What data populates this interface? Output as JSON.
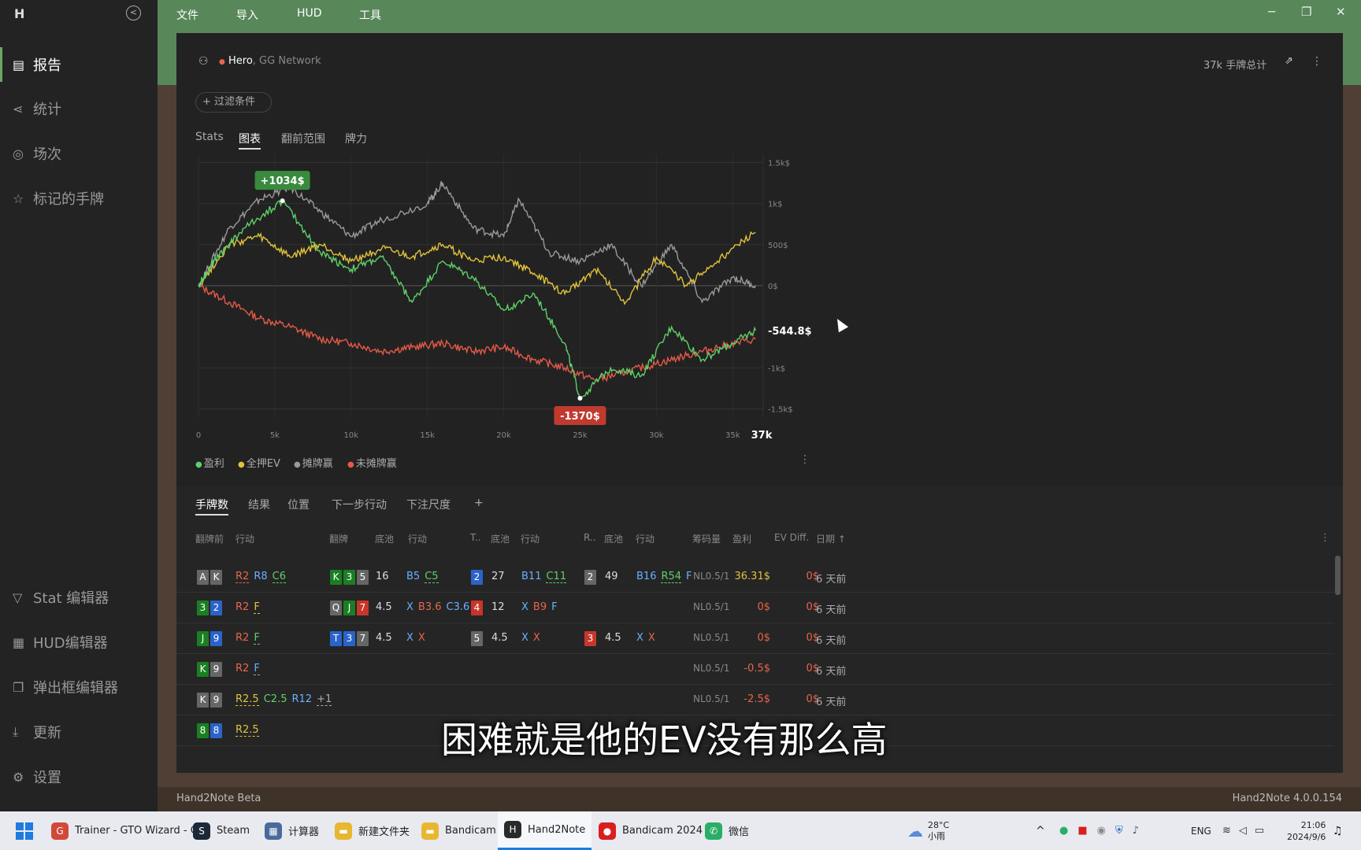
{
  "sidebar": {
    "logo": "H",
    "items": [
      {
        "label": "报告",
        "icon": "report-icon"
      },
      {
        "label": "统计",
        "icon": "share-icon"
      },
      {
        "label": "场次",
        "icon": "broadcast-icon"
      },
      {
        "label": "标记的手牌",
        "icon": "star-icon"
      }
    ],
    "bottom": [
      {
        "label": "Stat 编辑器",
        "icon": "filter-icon"
      },
      {
        "label": "HUD编辑器",
        "icon": "layout-icon"
      },
      {
        "label": "弹出框编辑器",
        "icon": "popup-icon"
      },
      {
        "label": "更新",
        "icon": "download-icon"
      },
      {
        "label": "设置",
        "icon": "gear-icon"
      }
    ]
  },
  "menu": [
    "文件",
    "导入",
    "HUD",
    "工具"
  ],
  "player": {
    "name": "Hero",
    "network": ", GG Network",
    "total": "37k 手牌总计"
  },
  "filter": "+ 过滤条件",
  "tabs": [
    "Stats",
    "图表",
    "翻前范围",
    "牌力"
  ],
  "chart_data": {
    "type": "line",
    "xlim": [
      0,
      37000
    ],
    "ylim": [
      -1600,
      1600
    ],
    "x_ticks": [
      "0",
      "5k",
      "10k",
      "15k",
      "20k",
      "25k",
      "30k",
      "35k"
    ],
    "x_end": "37k",
    "y_ticks": [
      "1.5k$",
      "1k$",
      "500$",
      "0$",
      "-1k$",
      "-1.5k$"
    ],
    "annotations": {
      "max": "+1034$",
      "min": "-1370$",
      "last": "-544.8$"
    },
    "series": [
      {
        "name": "盈利",
        "color": "#5fd068",
        "points": [
          [
            0,
            0
          ],
          [
            1000,
            300
          ],
          [
            3000,
            700
          ],
          [
            5500,
            1034
          ],
          [
            8000,
            400
          ],
          [
            10000,
            200
          ],
          [
            12000,
            350
          ],
          [
            14000,
            -200
          ],
          [
            16000,
            300
          ],
          [
            18000,
            100
          ],
          [
            20000,
            -300
          ],
          [
            22000,
            -100
          ],
          [
            24000,
            -700
          ],
          [
            25000,
            -1370
          ],
          [
            27000,
            -1000
          ],
          [
            29000,
            -1100
          ],
          [
            31000,
            -500
          ],
          [
            33000,
            -900
          ],
          [
            35000,
            -700
          ],
          [
            36500,
            -544.8
          ]
        ]
      },
      {
        "name": "全押EV",
        "color": "#e2c23b",
        "points": [
          [
            0,
            0
          ],
          [
            2000,
            500
          ],
          [
            4000,
            600
          ],
          [
            6000,
            350
          ],
          [
            8000,
            500
          ],
          [
            10000,
            300
          ],
          [
            12000,
            450
          ],
          [
            14000,
            350
          ],
          [
            16000,
            500
          ],
          [
            18000,
            300
          ],
          [
            20000,
            350
          ],
          [
            22000,
            150
          ],
          [
            24000,
            -100
          ],
          [
            26000,
            200
          ],
          [
            28000,
            -200
          ],
          [
            30000,
            350
          ],
          [
            32000,
            0
          ],
          [
            34000,
            300
          ],
          [
            36500,
            650
          ]
        ]
      },
      {
        "name": "摊牌赢",
        "color": "#9a9a9a",
        "points": [
          [
            0,
            0
          ],
          [
            2000,
            700
          ],
          [
            4000,
            1050
          ],
          [
            6000,
            1200
          ],
          [
            8000,
            900
          ],
          [
            10000,
            600
          ],
          [
            12000,
            800
          ],
          [
            15000,
            1000
          ],
          [
            16000,
            1250
          ],
          [
            18000,
            700
          ],
          [
            20000,
            600
          ],
          [
            21000,
            1050
          ],
          [
            23000,
            400
          ],
          [
            25000,
            300
          ],
          [
            27000,
            500
          ],
          [
            29000,
            0
          ],
          [
            31000,
            500
          ],
          [
            33000,
            -200
          ],
          [
            35000,
            100
          ],
          [
            36500,
            0
          ]
        ]
      },
      {
        "name": "未摊牌赢",
        "color": "#e55a48",
        "points": [
          [
            0,
            0
          ],
          [
            2000,
            -200
          ],
          [
            4000,
            -400
          ],
          [
            6000,
            -500
          ],
          [
            8000,
            -650
          ],
          [
            10000,
            -700
          ],
          [
            12000,
            -800
          ],
          [
            14000,
            -750
          ],
          [
            16000,
            -700
          ],
          [
            18000,
            -800
          ],
          [
            20000,
            -750
          ],
          [
            22000,
            -900
          ],
          [
            24000,
            -1000
          ],
          [
            26000,
            -1150
          ],
          [
            28000,
            -1050
          ],
          [
            30000,
            -950
          ],
          [
            32000,
            -850
          ],
          [
            34000,
            -750
          ],
          [
            36500,
            -650
          ]
        ]
      }
    ]
  },
  "table_tabs": [
    "手牌数",
    "结果",
    "位置",
    "下一步行动",
    "下注尺度",
    "+"
  ],
  "headers": [
    "翻牌前",
    "行动",
    "翻牌",
    "底池",
    "行动",
    "T..",
    "底池",
    "行动",
    "R..",
    "底池",
    "行动",
    "筹码量",
    "盈利",
    "EV Diff.",
    "日期 ↑"
  ],
  "rows": [
    {
      "hole": [
        [
          "A",
          "cd"
        ],
        [
          "K",
          "cd"
        ]
      ],
      "pre": [
        [
          "R2",
          "#e8664a",
          true
        ],
        [
          "R8",
          "#6ab0ff",
          false
        ],
        [
          "C6",
          "#5fd068",
          true
        ]
      ],
      "flop": [
        [
          "K",
          "cs"
        ],
        [
          "3",
          "cs"
        ],
        [
          "5",
          "cd"
        ]
      ],
      "fpot": "16",
      "fact": [
        [
          "B5",
          "#6ab0ff",
          false
        ],
        [
          "C5",
          "#5fd068",
          true
        ]
      ],
      "turn": [
        [
          "2",
          "cc"
        ]
      ],
      "tpot": "27",
      "tact": [
        [
          "B11",
          "#6ab0ff",
          false
        ],
        [
          "C11",
          "#5fd068",
          true
        ]
      ],
      "river": [
        [
          "2",
          "cd"
        ]
      ],
      "rpot": "49",
      "ract": [
        [
          "B16",
          "#6ab0ff",
          false
        ],
        [
          "R54",
          "#5fd068",
          true
        ],
        [
          "F",
          "#6ab0ff",
          false
        ]
      ],
      "stake": "NL0.5/1",
      "profit": "36.31$",
      "pcolor": "#e2c23b",
      "ev": "0$",
      "date": "6 天前"
    },
    {
      "hole": [
        [
          "3",
          "cs"
        ],
        [
          "2",
          "cc"
        ]
      ],
      "pre": [
        [
          "R2",
          "#e8664a",
          false
        ],
        [
          "F",
          "#e2c23b",
          true
        ]
      ],
      "flop": [
        [
          "Q",
          "cd"
        ],
        [
          "J",
          "cs"
        ],
        [
          "7",
          "ch"
        ]
      ],
      "fpot": "4.5",
      "fact": [
        [
          "X",
          "#6ab0ff",
          false
        ],
        [
          "B3.6",
          "#e8664a",
          false
        ],
        [
          "C3.6",
          "#6ab0ff",
          false
        ]
      ],
      "turn": [
        [
          "4",
          "ch"
        ]
      ],
      "tpot": "12",
      "tact": [
        [
          "X",
          "#6ab0ff",
          false
        ],
        [
          "B9",
          "#e8664a",
          false
        ],
        [
          "F",
          "#6ab0ff",
          false
        ]
      ],
      "river": [],
      "rpot": "",
      "ract": [],
      "stake": "NL0.5/1",
      "profit": "0$",
      "pcolor": "#e8664a",
      "ev": "0$",
      "date": "6 天前"
    },
    {
      "hole": [
        [
          "J",
          "cs"
        ],
        [
          "9",
          "cc"
        ]
      ],
      "pre": [
        [
          "R2",
          "#e8664a",
          false
        ],
        [
          "F",
          "#5fd068",
          true
        ]
      ],
      "flop": [
        [
          "T",
          "cc"
        ],
        [
          "3",
          "cc"
        ],
        [
          "7",
          "cd"
        ]
      ],
      "fpot": "4.5",
      "fact": [
        [
          "X",
          "#6ab0ff",
          false
        ],
        [
          "X",
          "#e8664a",
          false
        ]
      ],
      "turn": [
        [
          "5",
          "cd"
        ]
      ],
      "tpot": "4.5",
      "tact": [
        [
          "X",
          "#6ab0ff",
          false
        ],
        [
          "X",
          "#e8664a",
          false
        ]
      ],
      "river": [
        [
          "3",
          "ch"
        ]
      ],
      "rpot": "4.5",
      "ract": [
        [
          "X",
          "#6ab0ff",
          false
        ],
        [
          "X",
          "#e8664a",
          false
        ]
      ],
      "stake": "NL0.5/1",
      "profit": "0$",
      "pcolor": "#e8664a",
      "ev": "0$",
      "date": "6 天前"
    },
    {
      "hole": [
        [
          "K",
          "cs"
        ],
        [
          "9",
          "cd"
        ]
      ],
      "pre": [
        [
          "R2",
          "#e8664a",
          false
        ],
        [
          "F",
          "#6ab0ff",
          true
        ]
      ],
      "flop": [],
      "fpot": "",
      "fact": [],
      "turn": [],
      "tpot": "",
      "tact": [],
      "river": [],
      "rpot": "",
      "ract": [],
      "stake": "NL0.5/1",
      "profit": "-0.5$",
      "pcolor": "#e8664a",
      "ev": "0$",
      "date": "6 天前"
    },
    {
      "hole": [
        [
          "K",
          "cd"
        ],
        [
          "9",
          "cd"
        ]
      ],
      "pre": [
        [
          "R2.5",
          "#e2c23b",
          true
        ],
        [
          "C2.5",
          "#5fd068",
          false
        ],
        [
          "R12",
          "#6ab0ff",
          false
        ],
        [
          "+1",
          "#aaa",
          true
        ]
      ],
      "flop": [],
      "fpot": "",
      "fact": [],
      "turn": [],
      "tpot": "",
      "tact": [],
      "river": [],
      "rpot": "",
      "ract": [],
      "stake": "NL0.5/1",
      "profit": "-2.5$",
      "pcolor": "#e8664a",
      "ev": "0$",
      "date": "6 天前"
    },
    {
      "hole": [
        [
          "8",
          "cs"
        ],
        [
          "8",
          "cc"
        ]
      ],
      "pre": [
        [
          "R2.5",
          "#e2c23b",
          true
        ]
      ],
      "flop": [],
      "fpot": "",
      "fact": [],
      "turn": [],
      "tpot": "",
      "tact": [],
      "river": [],
      "rpot": "",
      "ract": [],
      "stake": "",
      "profit": "",
      "pcolor": "#e8664a",
      "ev": "",
      "date": ""
    }
  ],
  "subtitle": "困难就是他的EV没有那么高",
  "status": {
    "left": "Hand2Note Beta",
    "right": "Hand2Note 4.0.0.154"
  },
  "taskbar": {
    "apps": [
      {
        "label": "Trainer - GTO Wizard - C",
        "color": "#d04a3a"
      },
      {
        "label": "Steam",
        "color": "#1b2838"
      },
      {
        "label": "计算器",
        "color": "#4a6a9a"
      },
      {
        "label": "新建文件夹",
        "color": "#e8b732"
      },
      {
        "label": "Bandicam",
        "color": "#e8b732"
      },
      {
        "label": "Hand2Note",
        "color": "#2a2a2a"
      },
      {
        "label": "Bandicam 2024",
        "color": "#d81e1e"
      },
      {
        "label": "微信",
        "color": "#2aae67"
      }
    ],
    "weather_temp": "28°C",
    "weather_desc": "小雨",
    "lang": "ENG",
    "time": "21:06",
    "date": "2024/9/6"
  }
}
